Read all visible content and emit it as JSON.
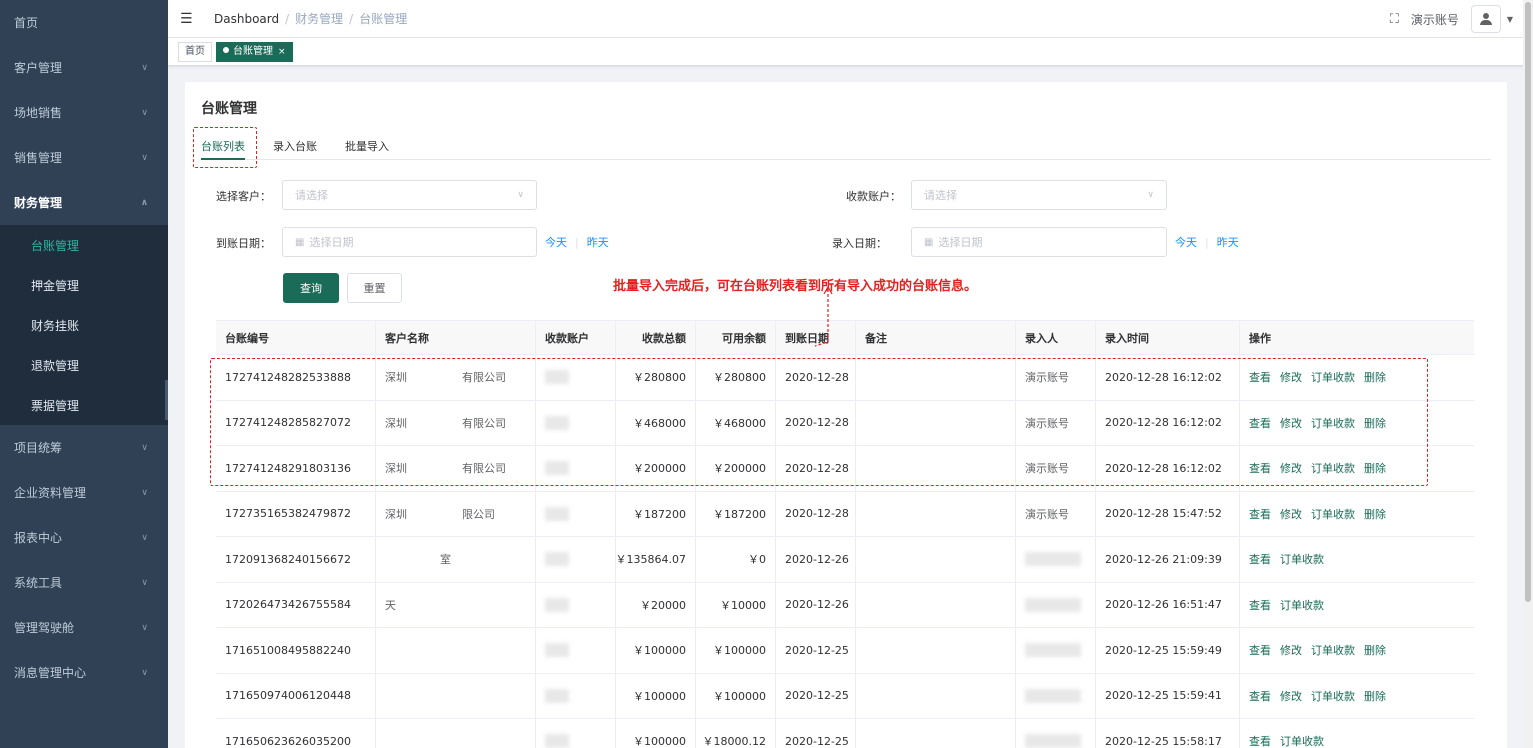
{
  "sidebar": {
    "items": [
      {
        "label": "首页"
      },
      {
        "label": "客户管理"
      },
      {
        "label": "场地销售"
      },
      {
        "label": "销售管理"
      },
      {
        "label": "财务管理"
      }
    ],
    "sub_items": [
      {
        "label": "台账管理"
      },
      {
        "label": "押金管理"
      },
      {
        "label": "财务挂账"
      },
      {
        "label": "退款管理"
      },
      {
        "label": "票据管理"
      }
    ],
    "items_after": [
      {
        "label": "项目统筹"
      },
      {
        "label": "企业资料管理"
      },
      {
        "label": "报表中心"
      },
      {
        "label": "系统工具"
      },
      {
        "label": "管理驾驶舱"
      },
      {
        "label": "消息管理中心"
      }
    ]
  },
  "navbar": {
    "breadcrumb": [
      "Dashboard",
      "财务管理",
      "台账管理"
    ],
    "account_name": "演示账号"
  },
  "tagsview": {
    "tags": [
      {
        "label": "首页"
      },
      {
        "label": "台账管理"
      }
    ]
  },
  "page": {
    "title": "台账管理",
    "tabs": [
      "台账列表",
      "录入台账",
      "批量导入"
    ]
  },
  "filters": {
    "customer_label": "选择客户：",
    "customer_placeholder": "请选择",
    "account_label": "收款账户：",
    "account_placeholder": "请选择",
    "arrival_label": "到账日期：",
    "arrival_placeholder": "选择日期",
    "entry_label": "录入日期：",
    "entry_placeholder": "选择日期",
    "today": "今天",
    "yesterday": "昨天",
    "query_button": "查询",
    "reset_button": "重置"
  },
  "annotation": "批量导入完成后，可在台账列表看到所有导入成功的台账信息。",
  "table": {
    "headers": [
      "台账编号",
      "客户名称",
      "收款账户",
      "收款总额",
      "可用余额",
      "到账日期",
      "备注",
      "录入人",
      "录入时间",
      "操作"
    ],
    "rows": [
      {
        "id": "172741248282533888",
        "customer": "深圳　　　　　有限公司",
        "account": "",
        "total": "￥280800",
        "balance": "￥280800",
        "date": "2020-12-28",
        "remark": "",
        "operator": "演示账号",
        "time": "2020-12-28 16:12:02",
        "actions": [
          "查看",
          "修改",
          "订单收款",
          "删除"
        ]
      },
      {
        "id": "172741248285827072",
        "customer": "深圳　　　　　有限公司",
        "account": "",
        "total": "￥468000",
        "balance": "￥468000",
        "date": "2020-12-28",
        "remark": "",
        "operator": "演示账号",
        "time": "2020-12-28 16:12:02",
        "actions": [
          "查看",
          "修改",
          "订单收款",
          "删除"
        ]
      },
      {
        "id": "172741248291803136",
        "customer": "深圳　　　　　有限公司",
        "account": "",
        "total": "￥200000",
        "balance": "￥200000",
        "date": "2020-12-28",
        "remark": "",
        "operator": "演示账号",
        "time": "2020-12-28 16:12:02",
        "actions": [
          "查看",
          "修改",
          "订单收款",
          "删除"
        ]
      },
      {
        "id": "172735165382479872",
        "customer": "深圳　　　　　限公司",
        "account": "",
        "total": "￥187200",
        "balance": "￥187200",
        "date": "2020-12-28",
        "remark": "",
        "operator": "演示账号",
        "time": "2020-12-28 15:47:52",
        "actions": [
          "查看",
          "修改",
          "订单收款",
          "删除"
        ]
      },
      {
        "id": "172091368240156672",
        "customer": "　　　　　室",
        "account": "",
        "total": "￥135864.07",
        "balance": "￥0",
        "date": "2020-12-26",
        "remark": "",
        "operator": "",
        "time": "2020-12-26 21:09:39",
        "actions": [
          "查看",
          "订单收款"
        ]
      },
      {
        "id": "172026473426755584",
        "customer": "天　　　　　",
        "account": "",
        "total": "￥20000",
        "balance": "￥10000",
        "date": "2020-12-26",
        "remark": "",
        "operator": "",
        "time": "2020-12-26 16:51:47",
        "actions": [
          "查看",
          "订单收款"
        ]
      },
      {
        "id": "171651008495882240",
        "customer": "",
        "account": "",
        "total": "￥100000",
        "balance": "￥100000",
        "date": "2020-12-25",
        "remark": "",
        "operator": "",
        "time": "2020-12-25 15:59:49",
        "actions": [
          "查看",
          "修改",
          "订单收款",
          "删除"
        ]
      },
      {
        "id": "171650974006120448",
        "customer": "",
        "account": "",
        "total": "￥100000",
        "balance": "￥100000",
        "date": "2020-12-25",
        "remark": "",
        "operator": "",
        "time": "2020-12-25 15:59:41",
        "actions": [
          "查看",
          "修改",
          "订单收款",
          "删除"
        ]
      },
      {
        "id": "171650623626035200",
        "customer": "",
        "account": "",
        "total": "￥100000",
        "balance": "￥18000.12",
        "date": "2020-12-25",
        "remark": "",
        "operator": "",
        "time": "2020-12-25 15:58:17",
        "actions": [
          "查看",
          "订单收款"
        ]
      }
    ]
  },
  "colors": {
    "accent": "#1a6b57",
    "sidebar_bg": "#304156",
    "annotation": "#e52020",
    "link": "#1890ff"
  }
}
